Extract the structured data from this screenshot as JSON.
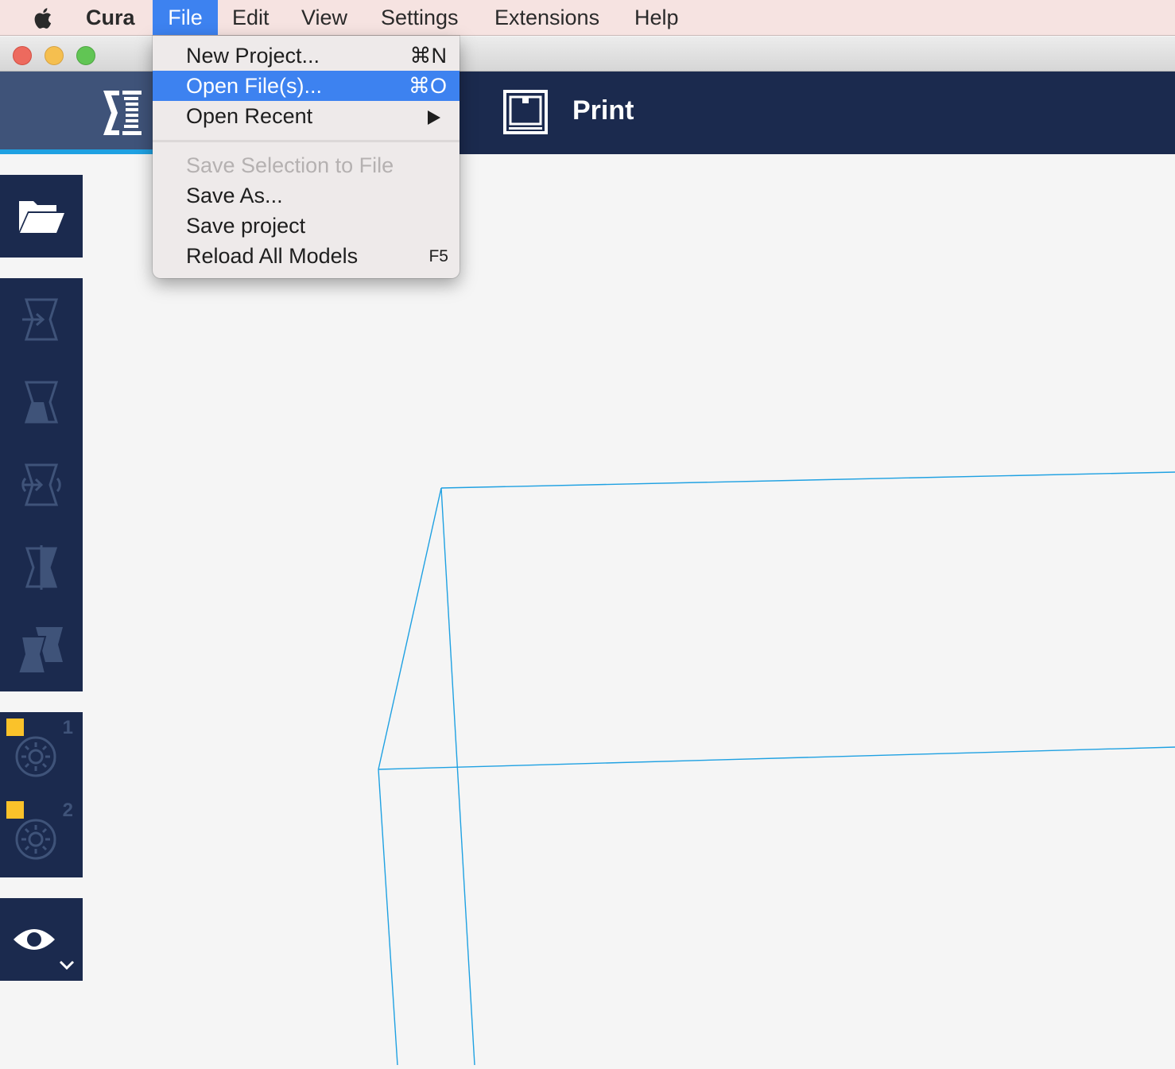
{
  "menubar": {
    "app_name": "Cura",
    "items": [
      {
        "label": "File",
        "active": true
      },
      {
        "label": "Edit"
      },
      {
        "label": "View"
      },
      {
        "label": "Settings"
      },
      {
        "label": "Extensions"
      },
      {
        "label": "Help"
      }
    ]
  },
  "window": {
    "buttons": [
      "close",
      "minimize",
      "zoom"
    ]
  },
  "header": {
    "logo_icon": "cura-logo-icon",
    "stage_icon": "printer-icon",
    "stage_label": "Print",
    "colors": {
      "bar": "#1b2a4e",
      "logo_bg": "#3f5379",
      "accent": "#1fa1e2"
    }
  },
  "file_menu": {
    "items": [
      {
        "label": "New Project...",
        "shortcut": "⌘N"
      },
      {
        "label": "Open File(s)...",
        "shortcut": "⌘O",
        "highlighted": true
      },
      {
        "label": "Open Recent",
        "submenu": true
      },
      {
        "label": "Save Selection to File",
        "disabled": true
      },
      {
        "label": "Save As..."
      },
      {
        "label": "Save project"
      },
      {
        "label": "Reload All Models",
        "shortcut": "F5"
      }
    ]
  },
  "toolbar": {
    "open_icon": "folder-open-icon",
    "tools": [
      "move-tool-icon",
      "scale-tool-icon",
      "rotate-tool-icon",
      "mirror-tool-icon",
      "per-model-settings-icon"
    ],
    "extruders": [
      {
        "number": "1",
        "color": "#fac22a"
      },
      {
        "number": "2",
        "color": "#fac22a"
      }
    ],
    "view_icon": "eye-icon"
  },
  "viewport": {
    "build_volume_color": "#1fa1e2",
    "background": "#f5f5f5"
  }
}
